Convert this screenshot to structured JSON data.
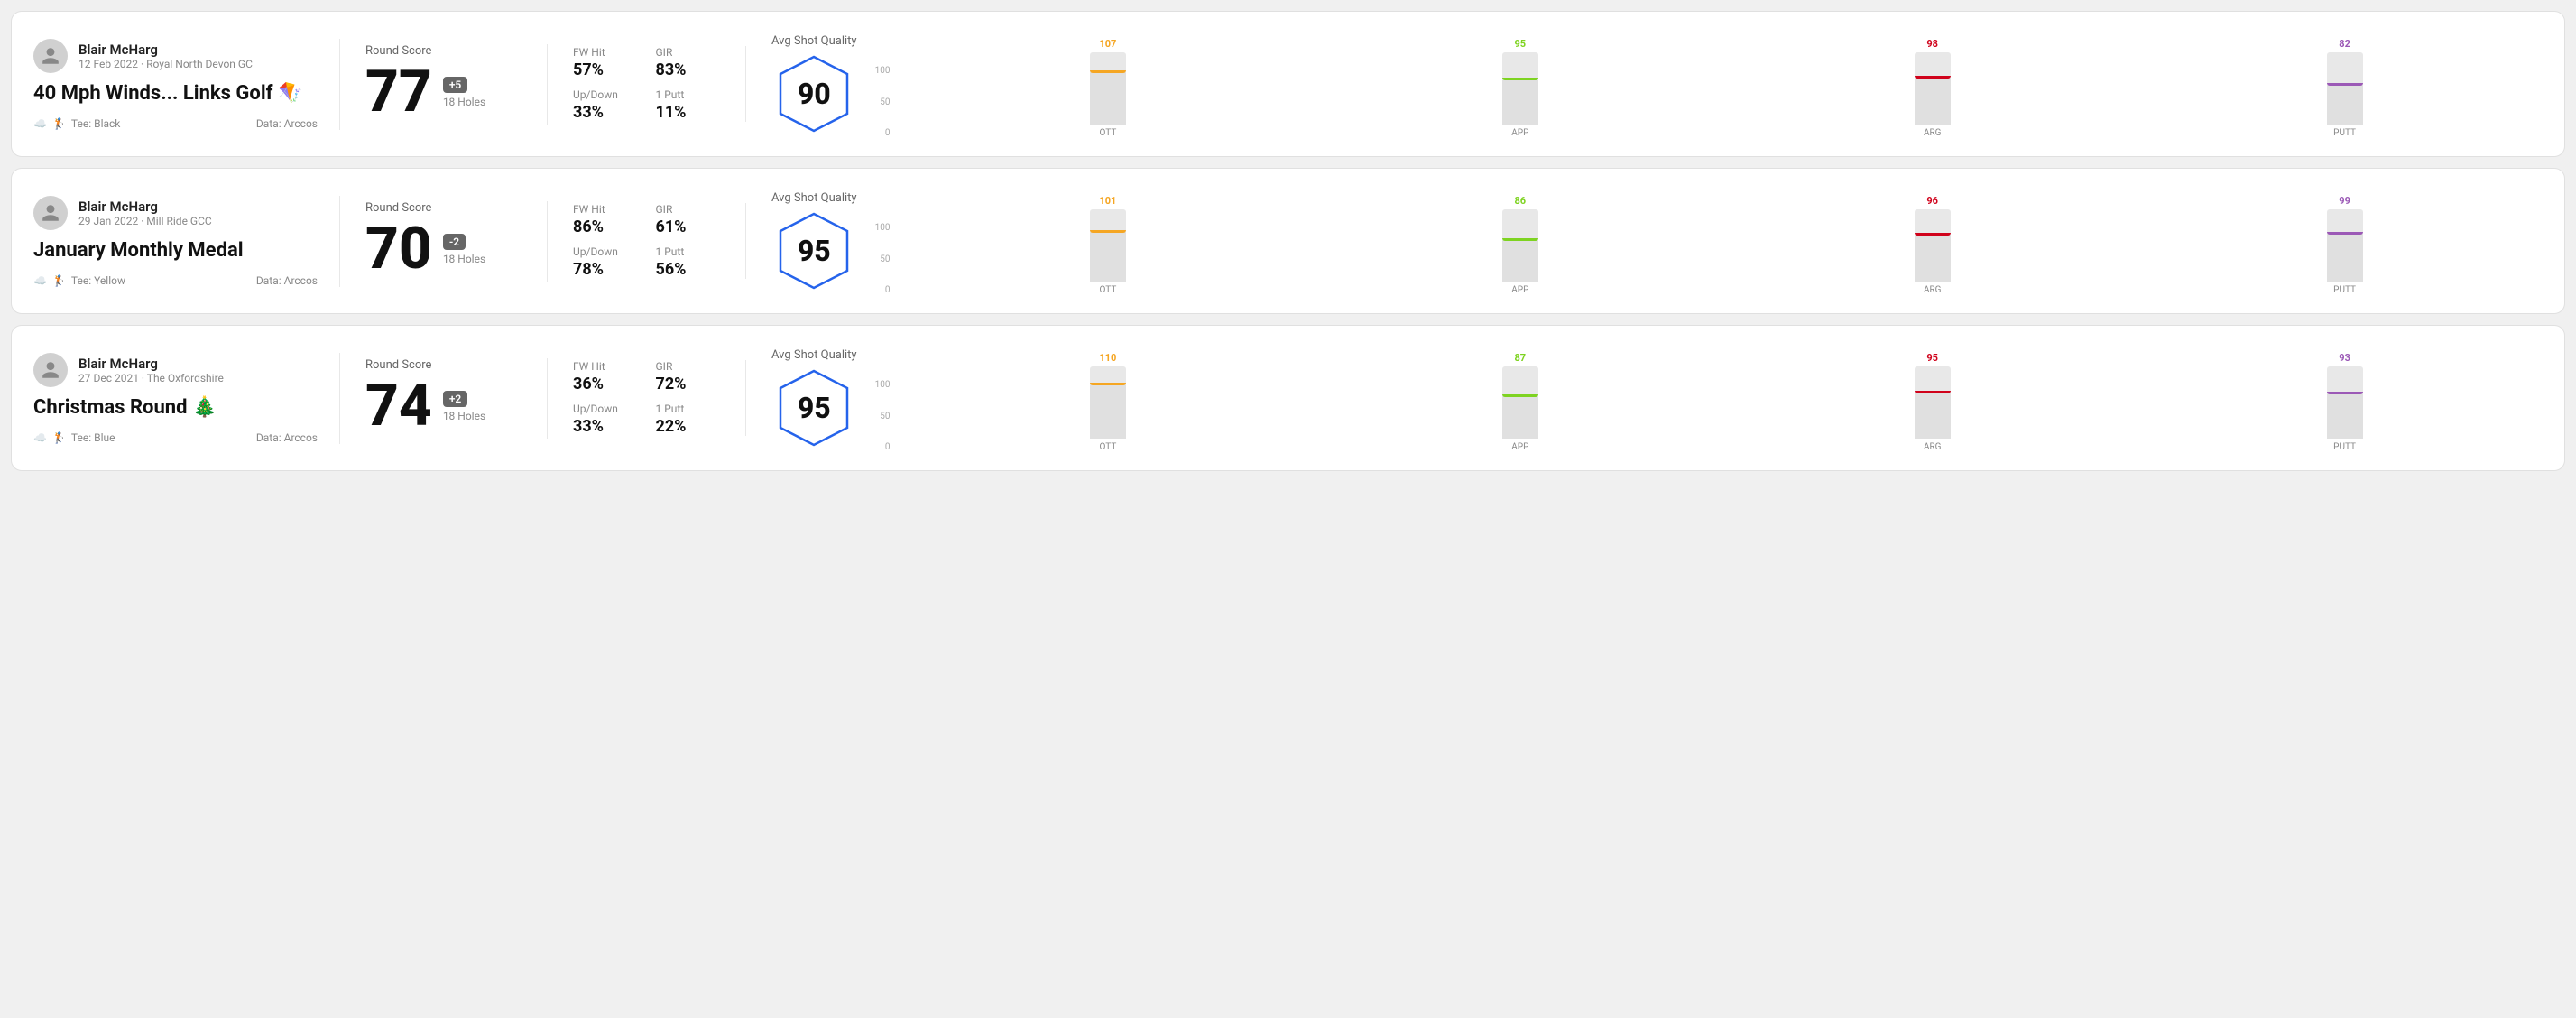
{
  "rounds": [
    {
      "id": "round1",
      "player_name": "Blair McHarg",
      "date": "12 Feb 2022 · Royal North Devon GC",
      "title": "40 Mph Winds... Links Golf 🪁",
      "tee": "Tee: Black",
      "data_source": "Data: Arccos",
      "score": "77",
      "score_diff": "+5",
      "score_diff_sign": "positive",
      "holes": "18 Holes",
      "fw_hit": "57%",
      "gir": "83%",
      "up_down": "33%",
      "one_putt": "11%",
      "avg_shot_quality": "90",
      "chart": {
        "bars": [
          {
            "label": "OTT",
            "value": 107,
            "color": "#f5a623",
            "pct": 75
          },
          {
            "label": "APP",
            "value": 95,
            "color": "#7ed321",
            "pct": 65
          },
          {
            "label": "ARG",
            "value": 98,
            "color": "#d0021b",
            "pct": 68
          },
          {
            "label": "PUTT",
            "value": 82,
            "color": "#9b59b6",
            "pct": 57
          }
        ]
      }
    },
    {
      "id": "round2",
      "player_name": "Blair McHarg",
      "date": "29 Jan 2022 · Mill Ride GCC",
      "title": "January Monthly Medal",
      "tee": "Tee: Yellow",
      "data_source": "Data: Arccos",
      "score": "70",
      "score_diff": "-2",
      "score_diff_sign": "negative",
      "holes": "18 Holes",
      "fw_hit": "86%",
      "gir": "61%",
      "up_down": "78%",
      "one_putt": "56%",
      "avg_shot_quality": "95",
      "chart": {
        "bars": [
          {
            "label": "OTT",
            "value": 101,
            "color": "#f5a623",
            "pct": 71
          },
          {
            "label": "APP",
            "value": 86,
            "color": "#7ed321",
            "pct": 60
          },
          {
            "label": "ARG",
            "value": 96,
            "color": "#d0021b",
            "pct": 67
          },
          {
            "label": "PUTT",
            "value": 99,
            "color": "#9b59b6",
            "pct": 69
          }
        ]
      }
    },
    {
      "id": "round3",
      "player_name": "Blair McHarg",
      "date": "27 Dec 2021 · The Oxfordshire",
      "title": "Christmas Round 🎄",
      "tee": "Tee: Blue",
      "data_source": "Data: Arccos",
      "score": "74",
      "score_diff": "+2",
      "score_diff_sign": "positive",
      "holes": "18 Holes",
      "fw_hit": "36%",
      "gir": "72%",
      "up_down": "33%",
      "one_putt": "22%",
      "avg_shot_quality": "95",
      "chart": {
        "bars": [
          {
            "label": "OTT",
            "value": 110,
            "color": "#f5a623",
            "pct": 77
          },
          {
            "label": "APP",
            "value": 87,
            "color": "#7ed321",
            "pct": 61
          },
          {
            "label": "ARG",
            "value": 95,
            "color": "#d0021b",
            "pct": 66
          },
          {
            "label": "PUTT",
            "value": 93,
            "color": "#9b59b6",
            "pct": 65
          }
        ]
      }
    }
  ],
  "labels": {
    "round_score": "Round Score",
    "fw_hit": "FW Hit",
    "gir": "GIR",
    "up_down": "Up/Down",
    "one_putt": "1 Putt",
    "avg_shot_quality": "Avg Shot Quality",
    "y_100": "100",
    "y_50": "50",
    "y_0": "0"
  }
}
